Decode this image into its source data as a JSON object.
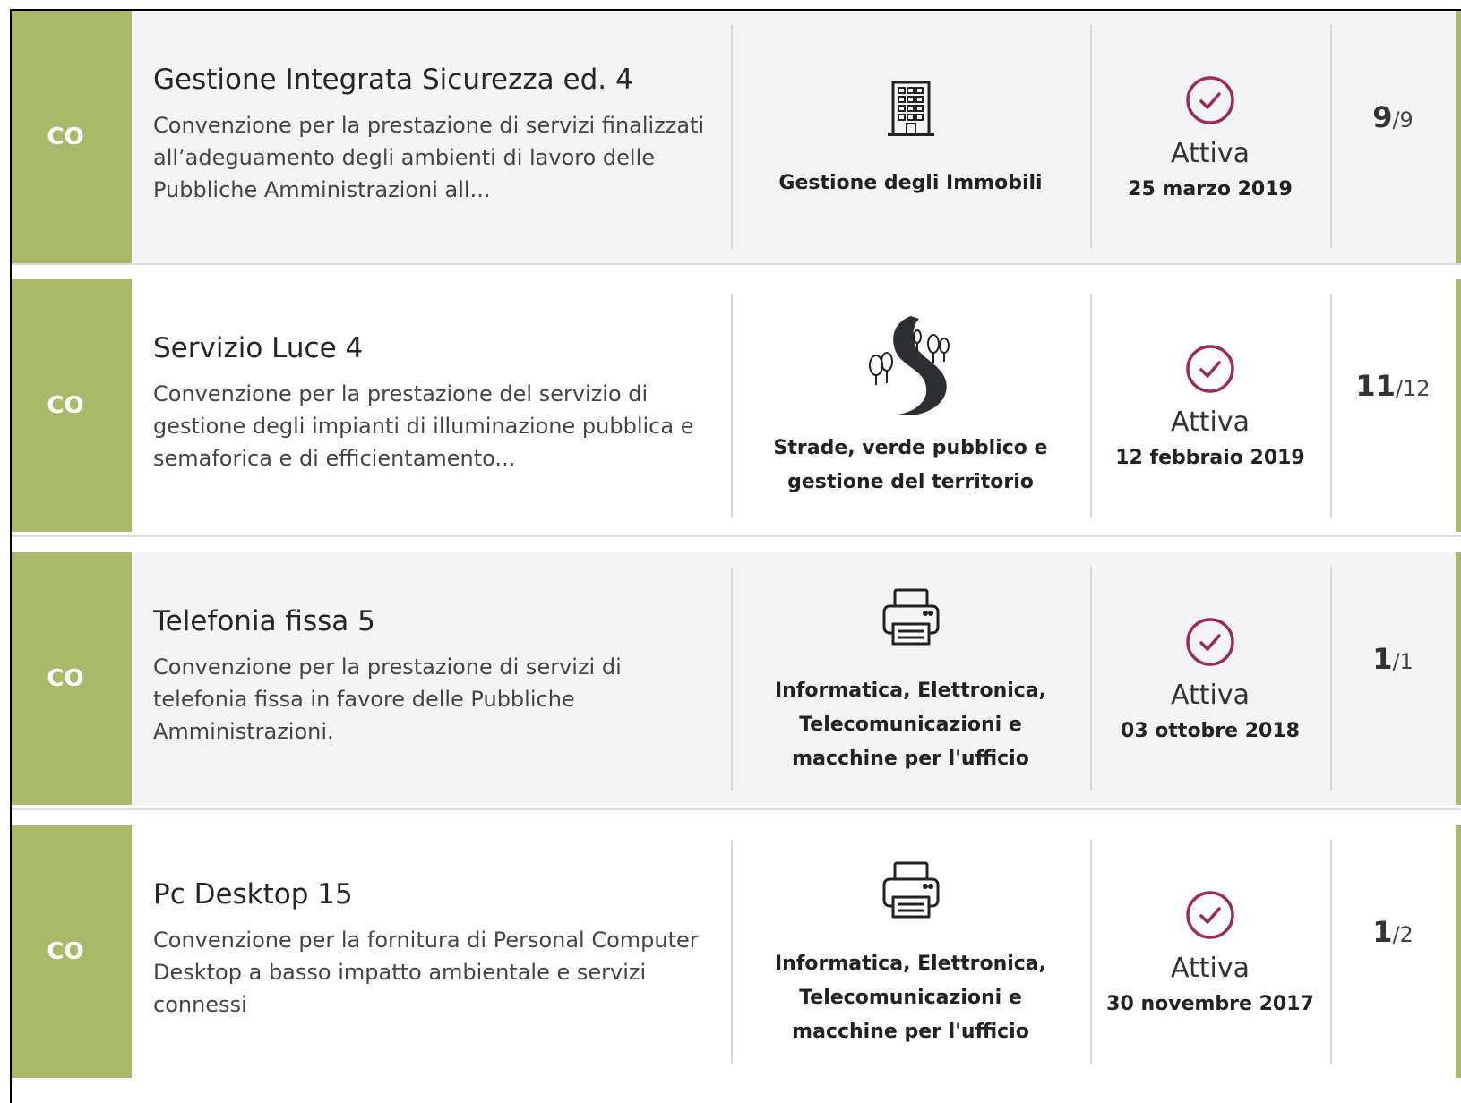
{
  "items": [
    {
      "tag": "CO",
      "title": "Gestione Integrata Sicurezza ed. 4",
      "description": "Convenzione per la prestazione di servizi finalizzati all’adeguamento degli ambienti di lavoro delle Pubbliche Amministrazioni all...",
      "category_icon": "building-icon",
      "category": "Gestione degli Immobili",
      "status": "Attiva",
      "date": "25 marzo 2019",
      "count": "9",
      "total": "/9"
    },
    {
      "tag": "CO",
      "title": "Servizio Luce 4",
      "description": "Convenzione per la prestazione del servizio di gestione degli impianti di illuminazione pubblica e semaforica e di efficientamento...",
      "category_icon": "road-trees-icon",
      "category": "Strade, verde pubblico e gestione del territorio",
      "status": "Attiva",
      "date": "12 febbraio 2019",
      "count": "11",
      "total": "/12"
    },
    {
      "tag": "CO",
      "title": "Telefonia fissa 5",
      "description": "Convenzione per la prestazione di servizi di telefonia fissa in favore delle Pubbliche Amministrazioni.",
      "category_icon": "printer-icon",
      "category": "Informatica, Elettronica, Telecomunicazioni e macchine per l'ufficio",
      "status": "Attiva",
      "date": "03 ottobre 2018",
      "count": "1",
      "total": "/1"
    },
    {
      "tag": "CO",
      "title": "Pc Desktop 15",
      "description": "Convenzione per la fornitura di Personal Computer Desktop a basso impatto ambientale e servizi connessi",
      "category_icon": "printer-icon",
      "category": "Informatica, Elettronica, Telecomunicazioni e macchine per l'ufficio",
      "status": "Attiva",
      "date": "30 novembre 2017",
      "count": "1",
      "total": "/2"
    }
  ],
  "colors": {
    "tag_green": "#a9b96a",
    "status_check": "#9b2a5a"
  }
}
